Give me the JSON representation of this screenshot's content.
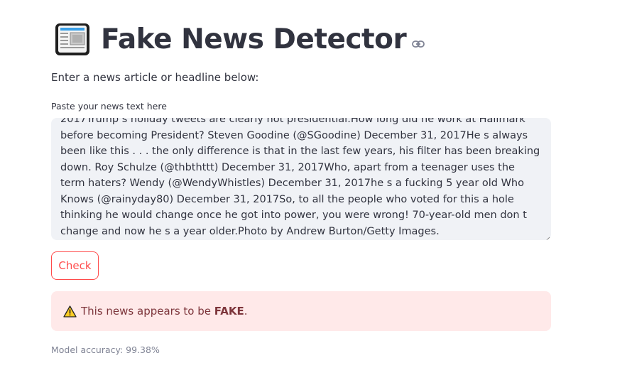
{
  "header": {
    "icon": "newspaper-emoji",
    "title": "Fake News Detector",
    "anchor_icon": "link-icon"
  },
  "intro_text": "Enter a news article or headline below:",
  "news_input": {
    "label": "Paste your news text here",
    "value": "2017Trump s holiday tweets are clearly not presidential.How long did he work at Hallmark before becoming President?  Steven Goodine (@SGoodine) December 31, 2017He s always been like this . . . the only difference is that in the last few years, his filter has been breaking down.  Roy Schulze (@thbthttt) December 31, 2017Who, apart from a teenager uses the term haters?  Wendy (@WendyWhistles) December 31, 2017he s a fucking 5 year old  Who Knows (@rainyday80) December 31, 2017So, to all the people who voted for this a hole thinking he would change once he got into power, you were wrong! 70-year-old men don t change and now he s a year older.Photo by Andrew Burton/Getty Images."
  },
  "check_button": {
    "label": "Check"
  },
  "result": {
    "icon": "warning-icon",
    "prefix": "This news appears to be ",
    "verdict": "FAKE",
    "suffix": "."
  },
  "accuracy_caption": "Model accuracy: 99.38%",
  "colors": {
    "accent": "#ff4b4b",
    "input_bg": "#f0f2f6",
    "error_bg": "#ffe9e9",
    "error_text": "#7d353b",
    "caption": "#808495"
  }
}
